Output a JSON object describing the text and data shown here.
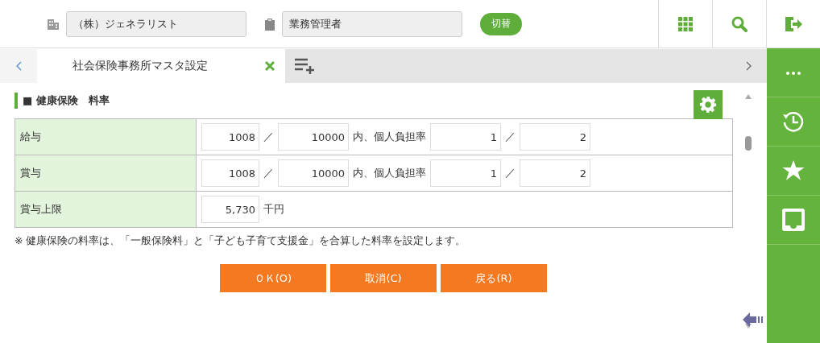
{
  "header": {
    "company": "（株）ジェネラリスト",
    "role": "業務管理者",
    "switch_button": "切替"
  },
  "tabs": [
    {
      "label": "社会保険事務所マスタ設定",
      "selected": true
    }
  ],
  "section": {
    "title": "■ 健康保険　料率"
  },
  "rows": [
    {
      "label": "給与",
      "parts": [
        {
          "kind": "field",
          "value": "1008"
        },
        {
          "kind": "text",
          "text": "／"
        },
        {
          "kind": "field",
          "value": "10000"
        },
        {
          "kind": "text",
          "text": "内、個人負担率"
        },
        {
          "kind": "field",
          "value": "1"
        },
        {
          "kind": "text",
          "text": "／"
        },
        {
          "kind": "field",
          "value": "2"
        }
      ]
    },
    {
      "label": "賞与",
      "parts": [
        {
          "kind": "field",
          "value": "1008"
        },
        {
          "kind": "text",
          "text": "／"
        },
        {
          "kind": "field",
          "value": "10000"
        },
        {
          "kind": "text",
          "text": "内、個人負担率"
        },
        {
          "kind": "field",
          "value": "1"
        },
        {
          "kind": "text",
          "text": "／"
        },
        {
          "kind": "field",
          "value": "2"
        }
      ]
    },
    {
      "label": "賞与上限",
      "parts": [
        {
          "kind": "field",
          "value": "5,730"
        },
        {
          "kind": "text",
          "text": "千円"
        }
      ]
    }
  ],
  "note": "※ 健康保険の料率は、「一般保険料」と「子ども子育て支援金」を合算した料率を設定します。",
  "buttons": [
    "ＯＫ(O)",
    "取消(C)",
    "戻る(R)"
  ]
}
